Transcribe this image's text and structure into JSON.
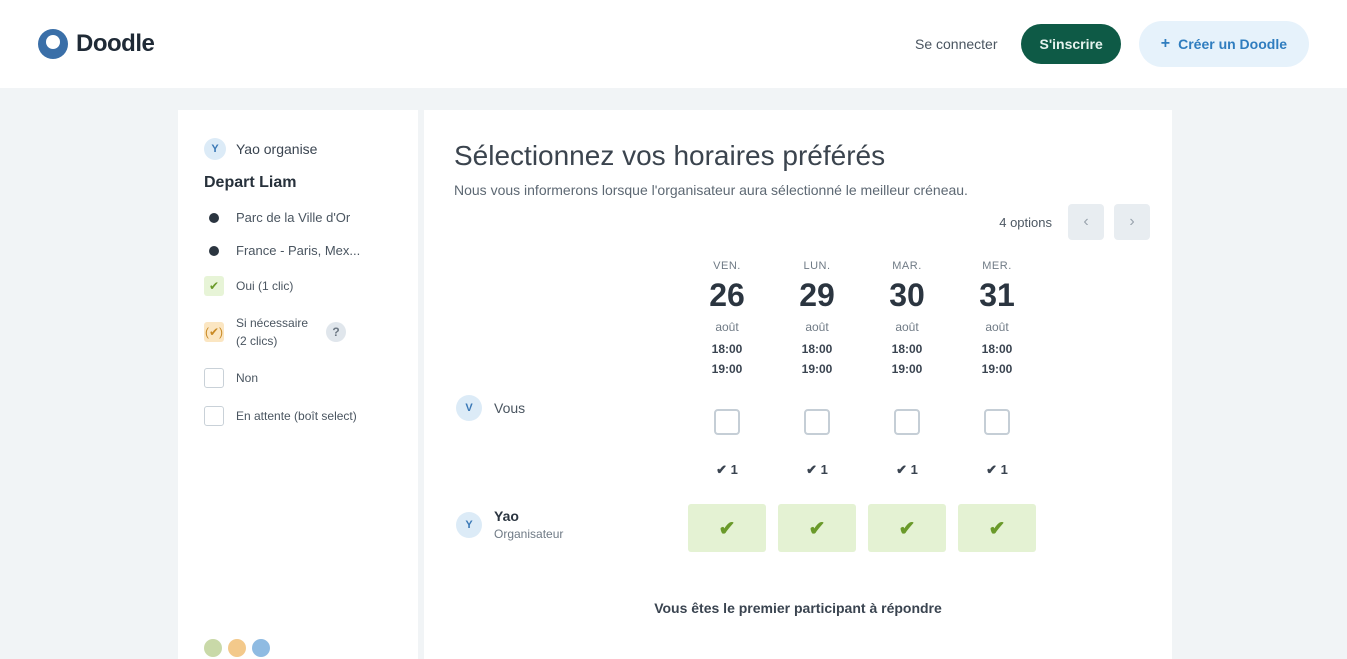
{
  "header": {
    "logo_text": "Doodle",
    "login_label": "Se connecter",
    "signup_label": "S'inscrire",
    "create_label": "Créer un Doodle",
    "create_icon": "plus-icon"
  },
  "sidebar": {
    "organizer_avatar": "Y",
    "organizer_label": "Yao organise",
    "event_title": "Depart Liam",
    "location": "Parc de la Ville d'Or",
    "timezone": "France - Paris, Mex...",
    "legend": {
      "yes": "Oui (1 clic)",
      "maybe_line1": "Si nécessaire",
      "maybe_line2": "(2 clics)",
      "no": "Non",
      "pending": "En attente (boît select)"
    },
    "help_icon": "?"
  },
  "main": {
    "title": "Sélectionnez vos horaires préférés",
    "subtitle": "Nous vous informerons lorsque l'organisateur aura sélectionné le meilleur créneau.",
    "options_count": "4 options",
    "prev_icon": "‹",
    "next_icon": "›",
    "columns": [
      {
        "dow": "VEN.",
        "day": "26",
        "month": "août",
        "start": "18:00",
        "end": "19:00",
        "count": "✔ 1"
      },
      {
        "dow": "LUN.",
        "day": "29",
        "month": "août",
        "start": "18:00",
        "end": "19:00",
        "count": "✔ 1"
      },
      {
        "dow": "MAR.",
        "day": "30",
        "month": "août",
        "start": "18:00",
        "end": "19:00",
        "count": "✔ 1"
      },
      {
        "dow": "MER.",
        "day": "31",
        "month": "août",
        "start": "18:00",
        "end": "19:00",
        "count": "✔ 1"
      }
    ],
    "you_label": "Vous",
    "you_avatar": "V",
    "organizer_row": {
      "avatar": "Y",
      "name": "Yao",
      "role": "Organisateur"
    },
    "yes_mark": "✔",
    "first_participant_msg": "Vous êtes le premier participant à répondre"
  },
  "colors": {
    "brand_dark_green": "#0e5a46",
    "accent_blue": "#2f7dbf",
    "yes_green": "#e4f2d3"
  }
}
